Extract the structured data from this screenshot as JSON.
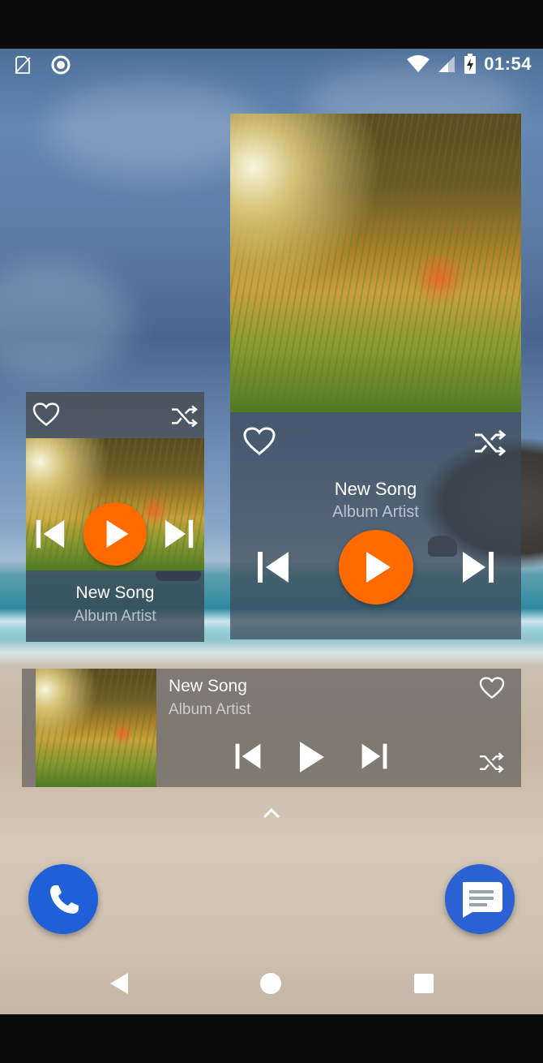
{
  "statusbar": {
    "time": "01:54",
    "icons": [
      "no-sim-icon",
      "circle-sync-icon",
      "wifi-icon",
      "cell-signal-icon",
      "battery-charging-icon"
    ]
  },
  "large_widget": {
    "song": "New Song",
    "artist": "Album Artist",
    "icons": [
      "heart-icon",
      "shuffle-icon",
      "previous-icon",
      "play-icon",
      "next-icon"
    ]
  },
  "small_widget": {
    "song": "New Song",
    "artist": "Album Artist",
    "icons": [
      "heart-icon",
      "shuffle-icon",
      "previous-icon",
      "play-icon",
      "next-icon"
    ]
  },
  "wide_widget": {
    "song": "New Song",
    "artist": "Album Artist",
    "icons": [
      "heart-icon",
      "shuffle-icon",
      "previous-icon",
      "play-icon",
      "next-icon"
    ]
  },
  "dock": {
    "apps": [
      "phone-icon",
      "messages-icon"
    ],
    "handle_icon": "chevron-up-icon"
  },
  "navbar": {
    "icons": [
      "back-icon",
      "home-icon",
      "recents-icon"
    ]
  },
  "colors": {
    "accent": "#ff6a00",
    "app_blue": "#1f5fd8"
  }
}
